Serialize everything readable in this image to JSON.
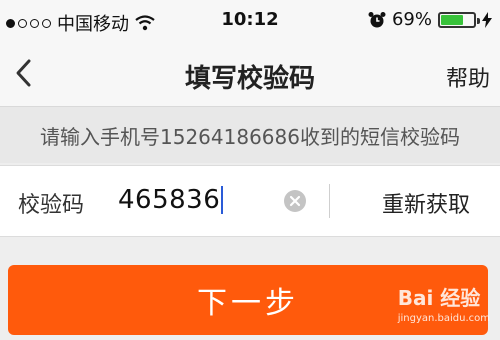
{
  "status_bar": {
    "carrier": "中国移动",
    "time": "10:12",
    "battery_percent": "69%",
    "battery_level": 0.69,
    "signal_bars_filled": 1,
    "signal_bars_total": 5,
    "icons": [
      "signal-dots-icon",
      "wifi-icon",
      "alarm-icon",
      "battery-icon",
      "charging-icon"
    ]
  },
  "nav": {
    "title": "填写校验码",
    "help_label": "帮助",
    "back_icon": "chevron-left-icon"
  },
  "hint": {
    "text": "请输入手机号15264186686收到的短信校验码"
  },
  "code_field": {
    "label": "校验码",
    "value": "465836",
    "clear_icon": "clear-circle-icon"
  },
  "resend_label": "重新获取",
  "next_button_label": "下一步",
  "watermark": {
    "logo_text": "Bai 经验",
    "url": "jingyan.baidu.com"
  },
  "colors": {
    "accent": "#ff5a0c",
    "caret": "#2a5bd7",
    "battery": "#38c23a"
  }
}
